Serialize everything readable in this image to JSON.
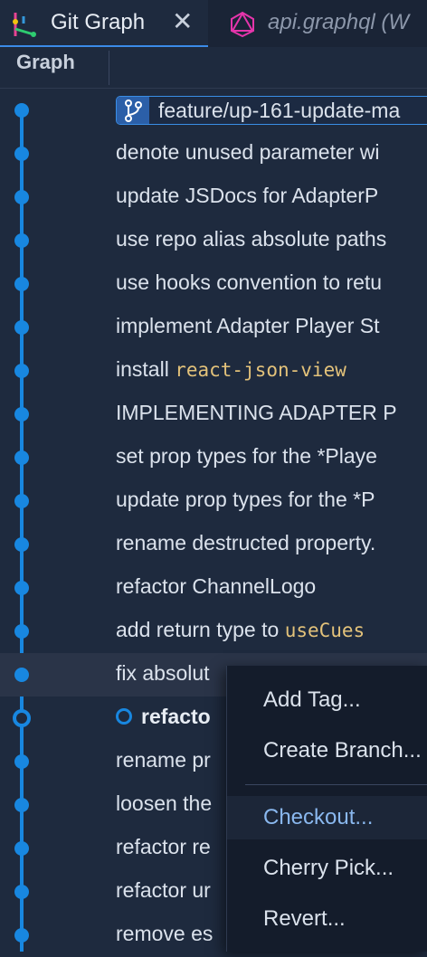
{
  "tabs": [
    {
      "label": "Git Graph",
      "icon": "git-graph-icon",
      "active": true
    },
    {
      "label": "api.graphql (W",
      "icon": "graphql-icon",
      "active": false
    }
  ],
  "columns": {
    "graph": "Graph"
  },
  "branch": {
    "name": "feature/up-161-update-ma",
    "icon": "branch-icon"
  },
  "commits": [
    "denote unused parameter wi",
    "update JSDocs for AdapterP",
    "use repo alias absolute paths",
    "use hooks convention to retu",
    "implement Adapter Player St",
    {
      "prefix": "install ",
      "code": "react-json-view"
    },
    "IMPLEMENTING ADAPTER P",
    "set prop types for the *Playe",
    "update prop types for the *P",
    "rename destructed property.",
    "refactor ChannelLogo",
    {
      "prefix": "add return type to ",
      "code": "useCues"
    },
    "fix absolut",
    {
      "bold": "refacto",
      "head": true
    },
    "rename pr",
    "loosen the",
    "refactor re",
    "refactor ur",
    "remove es"
  ],
  "context_menu": {
    "items": [
      "Add Tag...",
      "Create Branch...",
      "Checkout...",
      "Cherry Pick...",
      "Revert..."
    ],
    "active_index": 2
  },
  "colors": {
    "accent": "#1887e0",
    "code": "#e3c27a",
    "background": "#1e2a3e"
  }
}
